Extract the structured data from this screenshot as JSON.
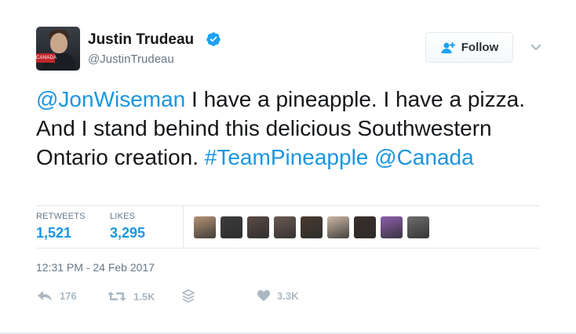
{
  "author": {
    "name": "Justin Trudeau",
    "handle": "@JustinTrudeau",
    "avatar_sign_text": "CANADA",
    "verified": true,
    "verified_color": "#1da1f2"
  },
  "follow_button": {
    "label": "Follow",
    "icon": "add-user-icon"
  },
  "tweet": {
    "mention_1": "@JonWiseman",
    "text": " I have a pineapple. I have a pizza. And I stand behind this delicious Southwestern Ontario creation. ",
    "hashtag": "#TeamPineapple",
    "mention_2": "@Canada"
  },
  "stats": {
    "retweets_label": "RETWEETS",
    "retweets_value": "1,521",
    "likes_label": "LIKES",
    "likes_value": "3,295"
  },
  "liker_avatars": [
    "#b49477",
    "#3e3c3d",
    "#5a4a44",
    "#6b5a52",
    "#4a3b30",
    "#cbb8a6",
    "#3b2e2a",
    "#8e5fae",
    "#6d6d6d"
  ],
  "timestamp": "12:31 PM - 24 Feb 2017",
  "actions": {
    "reply_count": "176",
    "retweet_count": "1.5K",
    "like_count": "3.3K"
  },
  "colors": {
    "link": "#1b95e0",
    "muted": "#657786",
    "action_gray": "#aab8c2"
  }
}
